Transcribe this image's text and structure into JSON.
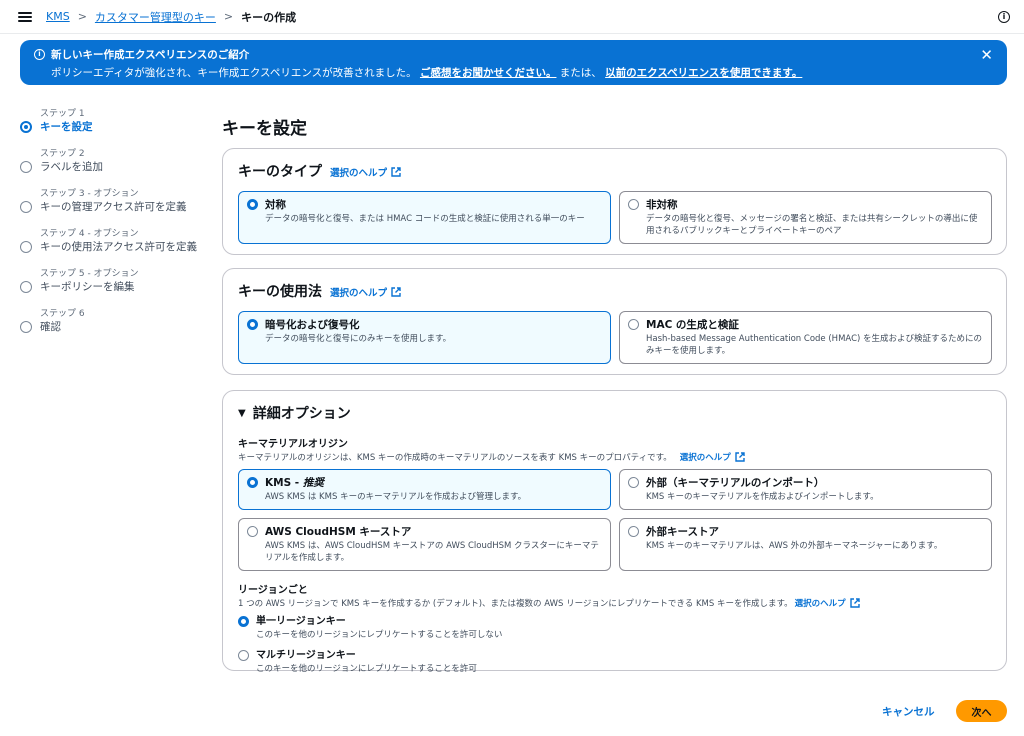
{
  "breadcrumb": {
    "items": [
      "KMS",
      "カスタマー管理型のキー"
    ],
    "current": "キーの作成"
  },
  "flash": {
    "title": "新しいキー作成エクスペリエンスのご紹介",
    "text1": "ポリシーエディタが強化され、キー作成エクスペリエンスが改善されました。",
    "link1": "ご感想をお聞かせください。",
    "text2": "または、",
    "link2": "以前のエクスペリエンスを使用できます。"
  },
  "steps": [
    {
      "num": "ステップ 1",
      "title": "キーを設定"
    },
    {
      "num": "ステップ 2",
      "title": "ラベルを追加"
    },
    {
      "num": "ステップ 3 - オプション",
      "title": "キーの管理アクセス許可を定義"
    },
    {
      "num": "ステップ 4 - オプション",
      "title": "キーの使用法アクセス許可を定義"
    },
    {
      "num": "ステップ 5 - オプション",
      "title": "キーポリシーを編集"
    },
    {
      "num": "ステップ 6",
      "title": "確認"
    }
  ],
  "page_title": "キーを設定",
  "help_label": "選択のヘルプ",
  "key_type": {
    "title": "キーのタイプ",
    "options": [
      {
        "title": "対称",
        "desc": "データの暗号化と復号、または HMAC コードの生成と検証に使用される単一のキー"
      },
      {
        "title": "非対称",
        "desc": "データの暗号化と復号、メッセージの署名と検証、または共有シークレットの導出に使用されるパブリックキーとプライベートキーのペア"
      }
    ]
  },
  "key_usage": {
    "title": "キーの使用法",
    "options": [
      {
        "title": "暗号化および復号化",
        "desc": "データの暗号化と復号にのみキーを使用します。"
      },
      {
        "title": "MAC の生成と検証",
        "desc": "Hash-based Message Authentication Code (HMAC) を生成および検証するためにのみキーを使用します。"
      }
    ]
  },
  "advanced": {
    "title": "詳細オプション",
    "origin_label": "キーマテリアルオリジン",
    "origin_desc": "キーマテリアルのオリジンは、KMS キーの作成時のキーマテリアルのソースを表す KMS キーのプロパティです。",
    "origin_options": [
      {
        "title": "KMS - ",
        "title_em": "推奨",
        "desc": "AWS KMS は KMS キーのキーマテリアルを作成および管理します。"
      },
      {
        "title": "外部（キーマテリアルのインポート）",
        "desc": "KMS キーのキーマテリアルを作成およびインポートします。"
      },
      {
        "title": "AWS CloudHSM キーストア",
        "desc": "AWS KMS は、AWS CloudHSM キーストアの AWS CloudHSM クラスターにキーマテリアルを作成します。"
      },
      {
        "title": "外部キーストア",
        "desc": "KMS キーのキーマテリアルは、AWS 外の外部キーマネージャーにあります。"
      }
    ],
    "region_label": "リージョンごと",
    "region_desc": "1 つの AWS リージョンで KMS キーを作成するか (デフォルト)、または複数の AWS リージョンにレプリケートできる KMS キーを作成します。",
    "region_options": [
      {
        "title": "単一リージョンキー",
        "desc": "このキーを他のリージョンにレプリケートすることを許可しない"
      },
      {
        "title": "マルチリージョンキー",
        "desc": "このキーを他のリージョンにレプリケートすることを許可"
      }
    ]
  },
  "buttons": {
    "cancel": "キャンセル",
    "next": "次へ"
  },
  "colors": {
    "accent": "#0972d3",
    "primary_button": "#ff9900",
    "flash_bg": "#0972d3"
  }
}
